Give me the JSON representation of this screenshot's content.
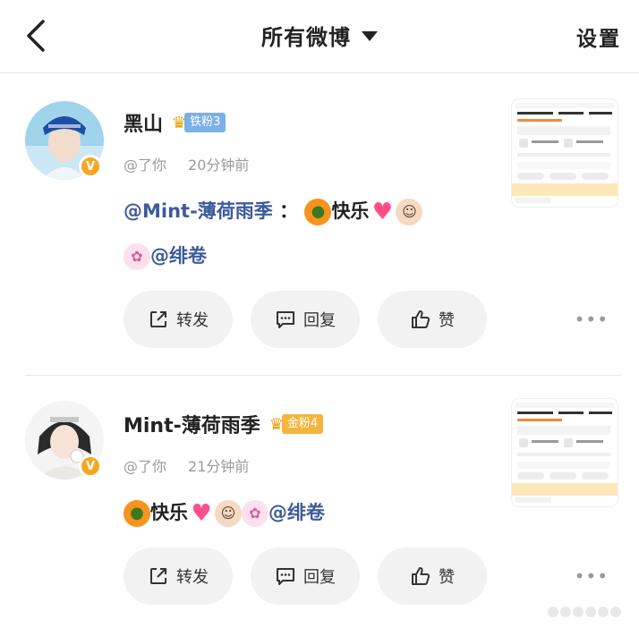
{
  "header": {
    "title": "所有微博",
    "settings": "设置"
  },
  "posts": [
    {
      "name": "黑山",
      "fan_badge": "铁粉3",
      "meta_user": "@了你",
      "meta_time": "20分钟前",
      "content_mention": "@Mint-薄荷雨季",
      "content_colon": "：",
      "content_text": "快乐",
      "content_mention2": "@绯卷",
      "actions": {
        "repost": "转发",
        "comment": "回复",
        "like": "赞"
      },
      "more": "•••"
    },
    {
      "name": "Mint-薄荷雨季",
      "fan_badge": "金粉4",
      "meta_user": "@了你",
      "meta_time": "21分钟前",
      "content_text": "快乐",
      "content_mention2": "@绯卷",
      "actions": {
        "repost": "转发",
        "comment": "回复",
        "like": "赞"
      },
      "more": "•••"
    }
  ],
  "colors": {
    "mention": "#3d5a9c",
    "verified": "#f5a623",
    "iron_badge": "#7ab0e8",
    "gold_badge": "#f3b63c"
  },
  "icons": {
    "back": "chevron-left-icon",
    "dropdown": "caret-down-icon",
    "repost": "share-icon",
    "comment": "comment-icon",
    "like": "thumbs-up-icon"
  }
}
